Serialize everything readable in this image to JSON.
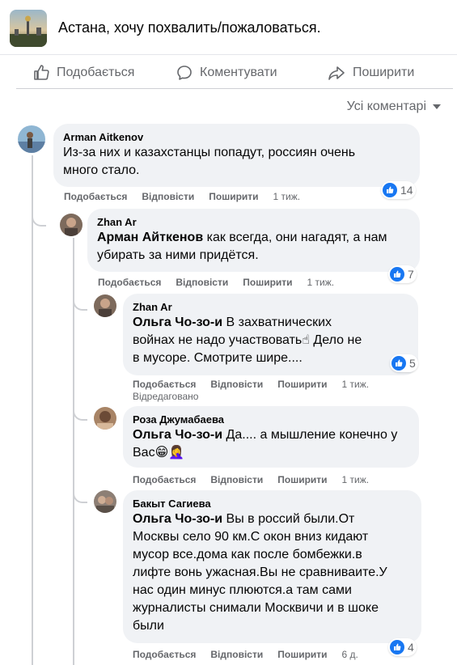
{
  "post": {
    "title": "Астана, хочу похвалить/пожаловаться."
  },
  "actions": {
    "like": "Подобається",
    "comment": "Коментувати",
    "share": "Поширити"
  },
  "sort": {
    "label": "Усі коментарі"
  },
  "comments": [
    {
      "author": "Arman Aitkenov",
      "mention": "",
      "lines": [
        "Из-за них и казахстанцы попадут, россиян очень",
        "много стало."
      ],
      "like": "Подобається",
      "reply": "Відповісти",
      "share": "Поширити",
      "time": "1 тиж.",
      "reactions": "14"
    },
    {
      "author": "Zhan Ar",
      "mention": "Арман Айткенов",
      "line1_rest": " как всегда, они нагадят, а нам",
      "lines": [
        "убирать за ними придётся."
      ],
      "like": "Подобається",
      "reply": "Відповісти",
      "share": "Поширити",
      "time": "1 тиж.",
      "reactions": "7"
    },
    {
      "author": "Zhan Ar",
      "mention": "Ольга Чо-зо-и",
      "line1_rest": " В захватнических",
      "lines": [
        "войнах не надо участвовать☝ Дело не",
        "в мусоре. Смотрите шире...."
      ],
      "like": "Подобається",
      "reply": "Відповісти",
      "share": "Поширити",
      "time": "1 тиж.",
      "edited": "Відредаговано",
      "reactions": "5"
    },
    {
      "author": "Роза Джумабаева",
      "mention": "Ольга Чо-зо-и",
      "line1_rest": " Да.... а мышление конечно у",
      "lines": [
        "Вас😁🤦‍♀️"
      ],
      "like": "Подобається",
      "reply": "Відповісти",
      "share": "Поширити",
      "time": "1 тиж."
    },
    {
      "author": "Бакыт Сагиева",
      "mention": "Ольга Чо-зо-и",
      "line1_rest": " Вы в россий были.От",
      "lines": [
        "Москвы село 90 км.С окон вниз кидают",
        "мусор все.дома как после бомбежки.в",
        "лифте вонь ужасная.Вы не сравниваите.У",
        "нас один минус плюются.а там сами",
        "журналисты снимали Москвичи и в шоке",
        "были"
      ],
      "like": "Подобається",
      "reply": "Відповісти",
      "share": "Поширити",
      "time": "6 д.",
      "reactions": "4"
    }
  ],
  "colors": {
    "accent": "#1877f2",
    "bubble": "#f0f2f5",
    "secondary_text": "#65676b"
  }
}
